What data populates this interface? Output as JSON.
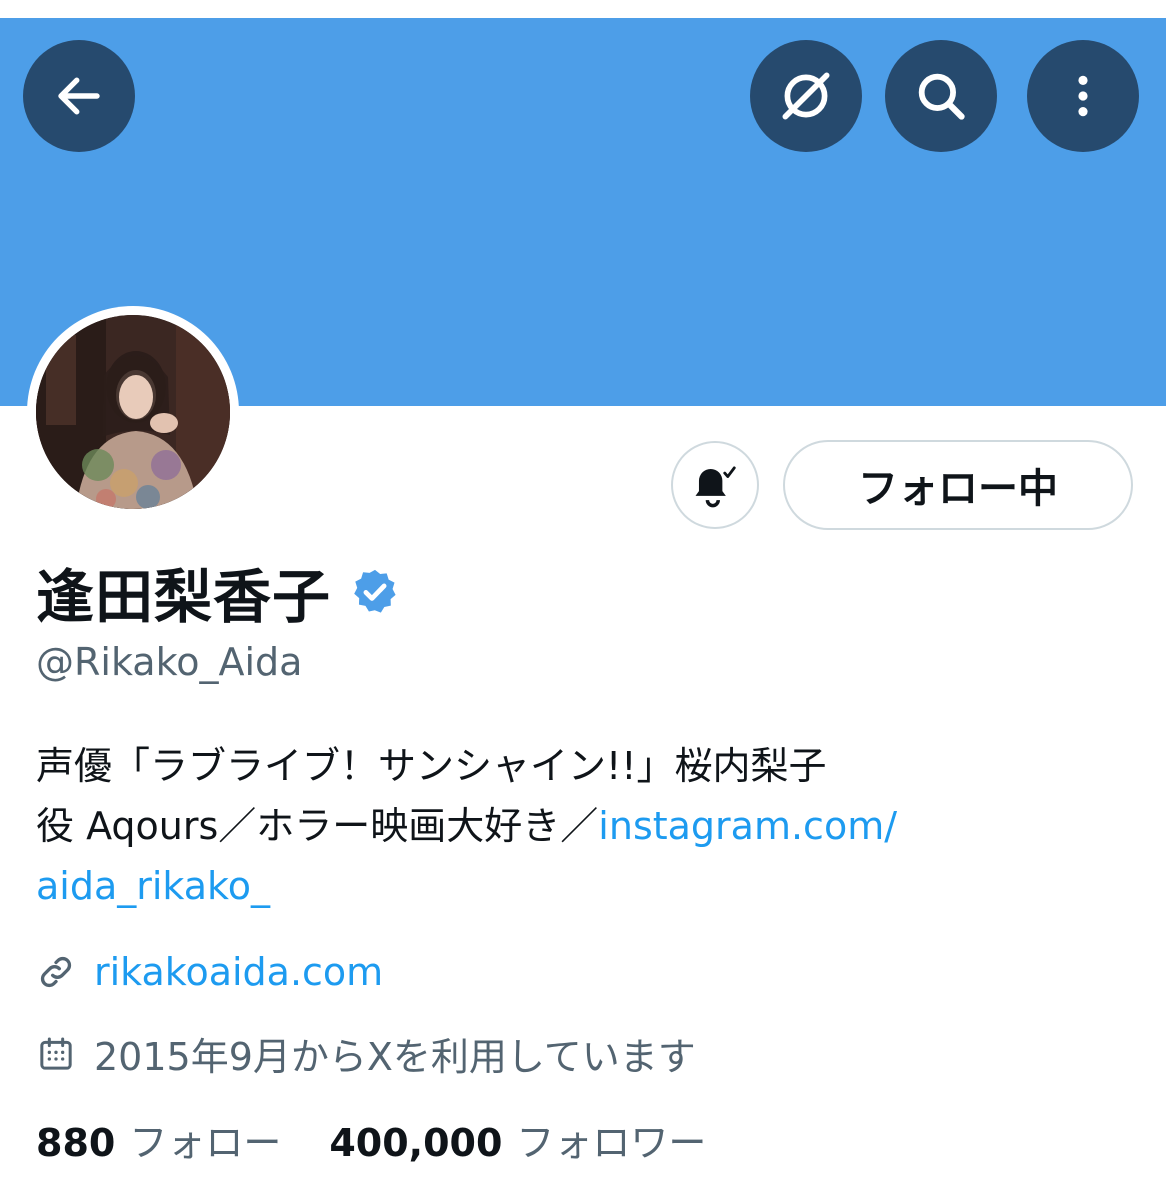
{
  "header": {
    "back_icon": "back-arrow-icon",
    "grok_icon": "grok-icon",
    "search_icon": "search-icon",
    "more_icon": "more-vertical-icon",
    "banner_color": "#4d9ee8"
  },
  "profile": {
    "name": "逢田梨香子",
    "handle": "@Rikako_Aida",
    "verified_color": "#1d9bf0",
    "follow_button": "フォロー中",
    "bio_text_1": "声優「ラブライブ！サンシャイン!!」桜内梨子",
    "bio_text_2": "役 Aqours／ホラー映画大好き／",
    "bio_link_1": "instagram.com/",
    "bio_link_2": "aida_rikako_",
    "website": "rikakoaida.com",
    "joined": "2015年9月からXを利用しています",
    "following_count": "880",
    "following_label": "フォロー",
    "followers_count": "400,000",
    "followers_label": "フォロワー"
  }
}
